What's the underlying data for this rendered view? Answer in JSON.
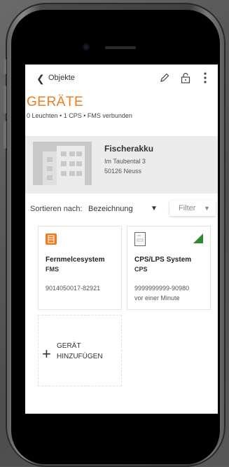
{
  "nav": {
    "back_label": "Objekte"
  },
  "page": {
    "title": "GERÄTE",
    "subtitle": "0 Leuchten  •  1 CPS  •  FMS verbunden"
  },
  "object": {
    "name": "Fischerakku",
    "street": "Im Taubental 3",
    "city": "50126 Neuss"
  },
  "sort": {
    "label": "Sortieren nach:",
    "value": "Bezeichnung",
    "caret": "▼"
  },
  "filter": {
    "label": "Filter",
    "caret": "▼"
  },
  "devices": [
    {
      "name": "Fernmelcesystem",
      "type": "FMS",
      "serial": "9014050017-82921",
      "time": "",
      "icon": "fms-icon",
      "icon_color": "#f07c20"
    },
    {
      "name": "CPS/LPS System",
      "type": "CPS",
      "serial": "9999999999-90980",
      "time": "vor einer Minute",
      "icon": "cps-icon",
      "status_color": "#2e8b2e"
    }
  ],
  "add_device": {
    "line1": "GERÄT",
    "line2": "HINZUFÜGEN"
  },
  "colors": {
    "accent": "#f07c20"
  }
}
